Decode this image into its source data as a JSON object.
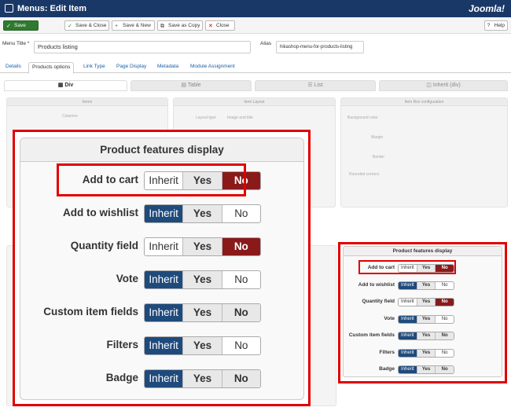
{
  "header": {
    "title": "Menus: Edit Item",
    "logo": "Joomla!"
  },
  "toolbar": {
    "save": "Save",
    "save_close": "Save & Close",
    "save_new": "Save & New",
    "save_copy": "Save as Copy",
    "close": "Close",
    "help": "Help"
  },
  "form": {
    "menu_title_label": "Menu Title *",
    "menu_title_value": "Products listing",
    "alias_label": "Alias",
    "alias_value": "hikashop-menu-for-products-listing"
  },
  "tabs": [
    "Details",
    "Products options",
    "Link Type",
    "Page Display",
    "Metadata",
    "Module Assignment"
  ],
  "subtabs": [
    "Div",
    "Table",
    "List",
    "Inherit (div)"
  ],
  "background": {
    "panel1": "Items",
    "columns": "Columns",
    "panel2": "Item Layout",
    "layout_type": "Layout type",
    "layout_value": "Image and title",
    "panel3": "Item Box configuration",
    "bg_color": "Background color",
    "margin": "Margin",
    "border": "Border",
    "rounded": "Rounded corners"
  },
  "features": {
    "title": "Product features display",
    "options": [
      "Inherit",
      "Yes",
      "No"
    ],
    "rows": [
      {
        "label": "Add to cart",
        "selected": "No"
      },
      {
        "label": "Add to wishlist",
        "selected": "Inherit"
      },
      {
        "label": "Quantity field",
        "selected": "No"
      },
      {
        "label": "Vote",
        "selected": "Inherit"
      },
      {
        "label": "Custom item fields",
        "selected": "Inherit"
      },
      {
        "label": "Filters",
        "selected": "Inherit"
      },
      {
        "label": "Badge",
        "selected": "Inherit"
      }
    ]
  },
  "colors": {
    "topbar": "#1a3867",
    "selected_blue": "#1f4a7c",
    "selected_red": "#8a1a1a",
    "highlight": "#e00000"
  }
}
